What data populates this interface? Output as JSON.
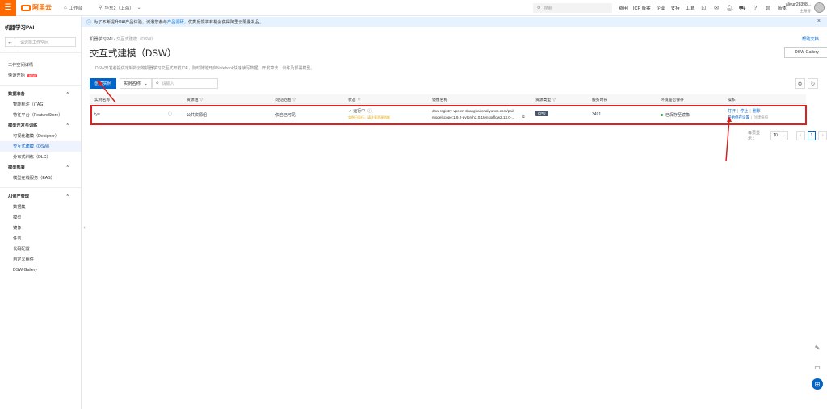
{
  "topbar": {
    "logo_text": "阿里云",
    "workbench": "工作台",
    "region": "华东2（上海）",
    "search_placeholder": "搜索",
    "links": [
      "费用",
      "ICP 备案",
      "企业",
      "支持",
      "工单"
    ],
    "lang": "简体",
    "user_name": "aliyun28398...",
    "user_sub": "主账号"
  },
  "sidebar": {
    "title": "机器学习PAI",
    "workspace_placeholder": "请选择工作空间",
    "items": [
      {
        "label": "工作空间详情",
        "type": "item"
      },
      {
        "label": "快速开始",
        "type": "item",
        "badge": "NEW"
      },
      {
        "label": "数据准备",
        "type": "group"
      },
      {
        "label": "智能标注（iTAG）",
        "type": "sub"
      },
      {
        "label": "特征平台（FeatureStore）",
        "type": "sub"
      },
      {
        "label": "模型开发与训练",
        "type": "group"
      },
      {
        "label": "可视化建模（Designer）",
        "type": "sub"
      },
      {
        "label": "交互式建模（DSW）",
        "type": "sub",
        "active": true
      },
      {
        "label": "分布式训练（DLC）",
        "type": "sub"
      },
      {
        "label": "模型部署",
        "type": "group"
      },
      {
        "label": "模型在线服务（EAS）",
        "type": "sub"
      },
      {
        "label": "AI资产管理",
        "type": "group"
      },
      {
        "label": "数据集",
        "type": "sub"
      },
      {
        "label": "模型",
        "type": "sub"
      },
      {
        "label": "镜像",
        "type": "sub"
      },
      {
        "label": "任务",
        "type": "sub"
      },
      {
        "label": "代码配置",
        "type": "sub"
      },
      {
        "label": "自定义组件",
        "type": "sub"
      },
      {
        "label": "DSW Gallery",
        "type": "sub"
      }
    ]
  },
  "notice": {
    "text": "为了不断提升PAI产品体验，诚邀您参与",
    "link": "产品调研",
    "tail": "，优秀反馈将有机会获得阿里云限量礼品。"
  },
  "main": {
    "breadcrumb_root": "机器学习PAI",
    "breadcrumb_current": "交互式建模（DSW）",
    "help": "帮助文档",
    "title": "交互式建模（DSW）",
    "gallery_button": "DSW Gallery",
    "description": "DSW开发者提供定制的云端机器学习交互式开发IDE，随时随地开启Notebook快速读写数据、开发算法、训练及部署模型。",
    "create_button": "创建实例",
    "filter_select": "实例名称",
    "filter_placeholder": "请输入"
  },
  "table": {
    "headers": [
      "实例名称",
      "资源组",
      "可见范围",
      "状态",
      "镜像名称",
      "资源类型",
      "服务时长",
      "环境是否保存",
      "操作"
    ],
    "rows": [
      {
        "name": "tyu",
        "resource_group": "公共资源组",
        "visibility": "仅自己可见",
        "status": "运行中",
        "status_sub": "实例已运行，请注意资源消耗",
        "image_line1": "dsw-registry-vpc.cn-shanghai.cr.aliyuncs.com/pai/",
        "image_line2": "modelscope:1.9.2-pytorch2.0.1tensorflow2.13.0-...",
        "resource_type": "CPU",
        "duration": "3491",
        "env_saved": "已保存至镜像",
        "ops": [
          "打开",
          "停止",
          "删除"
        ],
        "ops2": [
          "开始保存设置",
          "创建快照"
        ]
      }
    ]
  },
  "pager": {
    "label": "每页显示：",
    "size": "10",
    "page": "1"
  }
}
